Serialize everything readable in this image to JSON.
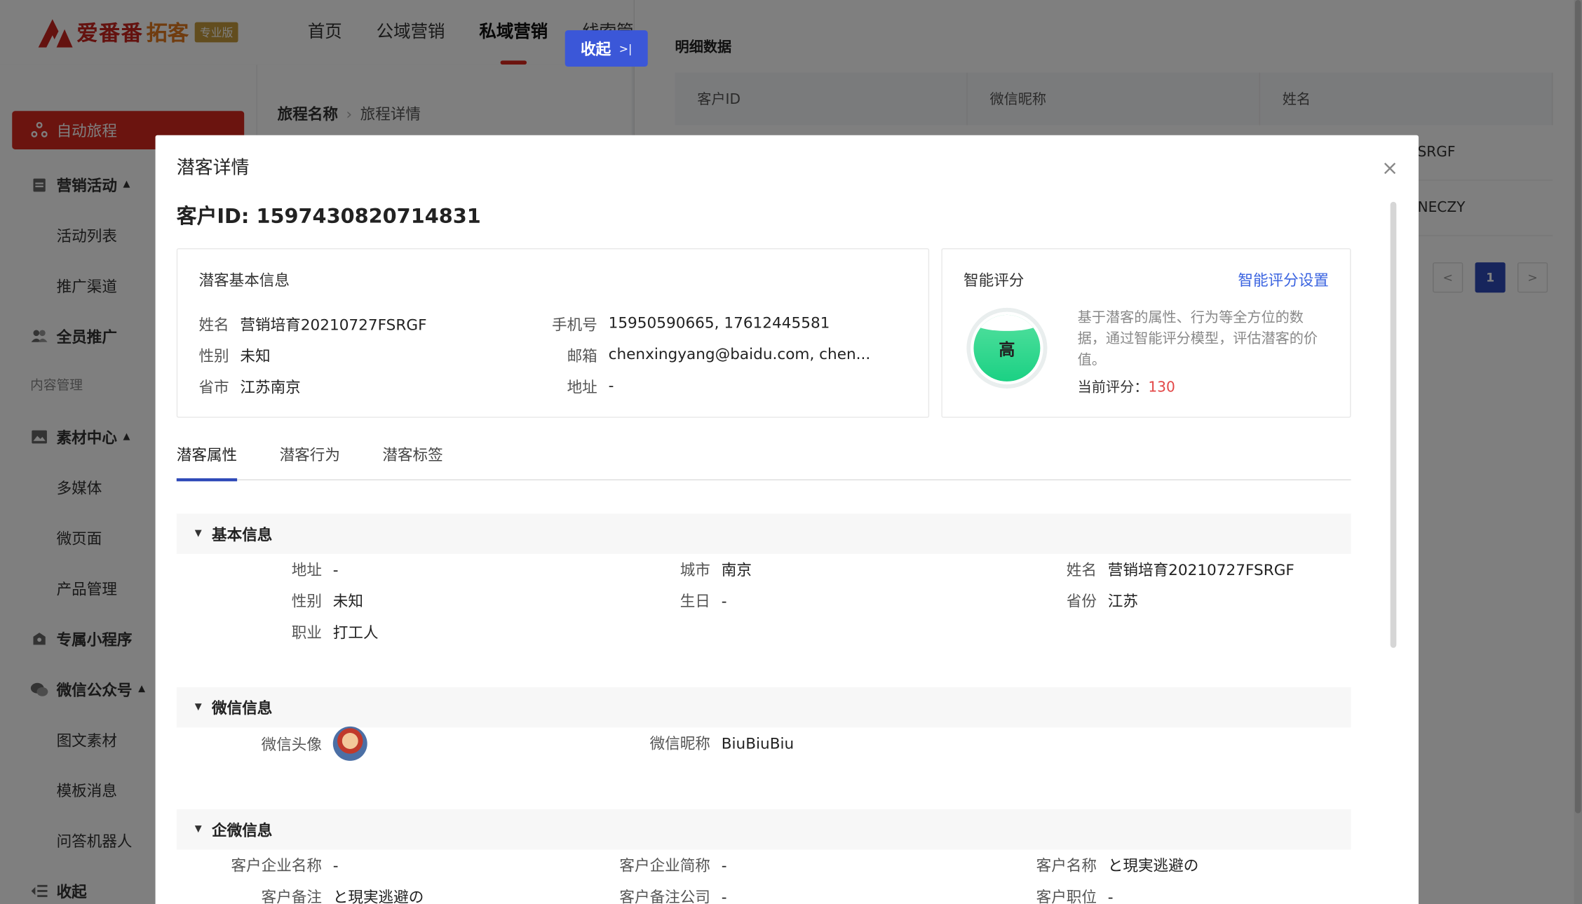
{
  "app": {
    "logo_text": "爱番番",
    "logo_text2": "拓客",
    "logo_badge": "专业版"
  },
  "nav": {
    "items": [
      "首页",
      "公域营销",
      "私域营销",
      "线索管"
    ],
    "active_index": 2
  },
  "sidebar": {
    "items": [
      {
        "label": "自动旅程",
        "type": "active",
        "icon": "journey-icon"
      },
      {
        "label": "营销活动",
        "type": "group",
        "icon": "calendar-icon",
        "caret": "▲"
      },
      {
        "label": "活动列表",
        "type": "child"
      },
      {
        "label": "推广渠道",
        "type": "child"
      },
      {
        "label": "全员推广",
        "type": "group",
        "icon": "users-icon"
      },
      {
        "label": "内容管理",
        "type": "section"
      },
      {
        "label": "素材中心",
        "type": "group",
        "icon": "image-icon",
        "caret": "▲"
      },
      {
        "label": "多媒体",
        "type": "child"
      },
      {
        "label": "微页面",
        "type": "child"
      },
      {
        "label": "产品管理",
        "type": "child"
      },
      {
        "label": "专属小程序",
        "type": "group",
        "icon": "miniapp-icon"
      },
      {
        "label": "微信公众号",
        "type": "group",
        "icon": "wechat-icon",
        "caret": "▲"
      },
      {
        "label": "图文素材",
        "type": "child"
      },
      {
        "label": "模板消息",
        "type": "child"
      },
      {
        "label": "问答机器人",
        "type": "child"
      },
      {
        "label": "收起",
        "type": "group",
        "icon": "collapse-icon"
      }
    ]
  },
  "breadcrumb": {
    "parent": "旅程名称",
    "current": "旅程详情"
  },
  "collapse_button": {
    "label": "收起",
    "glyph": ">|"
  },
  "detail_pane": {
    "title": "明细数据",
    "columns": [
      "客户ID",
      "微信昵称",
      "姓名"
    ],
    "rows": [
      "SRGF",
      "NECZY"
    ],
    "pager": {
      "prev": "<",
      "current": "1",
      "next": ">"
    }
  },
  "modal": {
    "title": "潜客详情",
    "close": "×",
    "customer_id_label": "客户ID: 1597430820714831",
    "basic": {
      "title": "潜客基本信息",
      "name_k": "姓名",
      "name_v": "营销培育20210727FSRGF",
      "gender_k": "性别",
      "gender_v": "未知",
      "region_k": "省市",
      "region_v": "江苏南京",
      "phone_k": "手机号",
      "phone_v": "15950590665, 17612445581",
      "email_k": "邮箱",
      "email_v": "chenxingyang@baidu.com, chen...",
      "addr_k": "地址",
      "addr_v": "-"
    },
    "score": {
      "title": "智能评分",
      "settings_link": "智能评分设置",
      "level": "高",
      "description": "基于潜客的属性、行为等全方位的数据，通过智能评分模型，评估潜客的价值。",
      "current_label": "当前评分：",
      "current_value": "130"
    },
    "tabs": [
      "潜客属性",
      "潜客行为",
      "潜客标签"
    ],
    "sections": {
      "basic_title": "基本信息",
      "basic": {
        "addr_k": "地址",
        "addr_v": "-",
        "city_k": "城市",
        "city_v": "南京",
        "name_k": "姓名",
        "name_v": "营销培育20210727FSRGF",
        "gender_k": "性别",
        "gender_v": "未知",
        "birthday_k": "生日",
        "birthday_v": "-",
        "province_k": "省份",
        "province_v": "江苏",
        "job_k": "职业",
        "job_v": "打工人"
      },
      "wechat_title": "微信信息",
      "wechat": {
        "avatar_k": "微信头像",
        "nick_k": "微信昵称",
        "nick_v": "BiuBiuBiu"
      },
      "wecom_title": "企微信息",
      "wecom": {
        "corp_k": "客户企业名称",
        "corp_v": "-",
        "corp_short_k": "客户企业简称",
        "corp_short_v": "-",
        "cust_name_k": "客户名称",
        "cust_name_v": "と現実逃避の",
        "remark_k": "客户备注",
        "remark_v": "と現実逃避の",
        "remark_corp_k": "客户备注公司",
        "remark_corp_v": "-",
        "position_k": "客户职位",
        "position_v": "-"
      }
    }
  }
}
